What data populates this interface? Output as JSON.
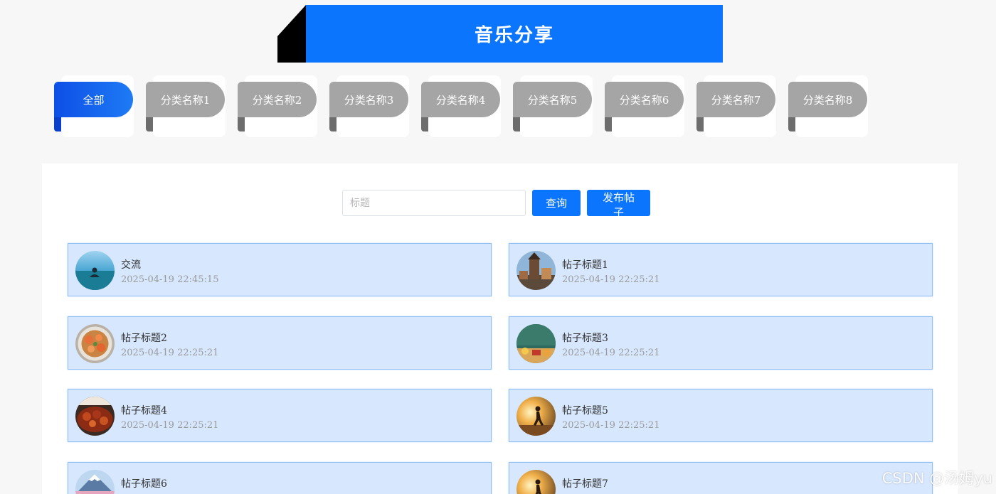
{
  "header": {
    "title": "音乐分享"
  },
  "tabs": [
    {
      "label": "全部",
      "active": true
    },
    {
      "label": "分类名称1",
      "active": false
    },
    {
      "label": "分类名称2",
      "active": false
    },
    {
      "label": "分类名称3",
      "active": false
    },
    {
      "label": "分类名称4",
      "active": false
    },
    {
      "label": "分类名称5",
      "active": false
    },
    {
      "label": "分类名称6",
      "active": false
    },
    {
      "label": "分类名称7",
      "active": false
    },
    {
      "label": "分类名称8",
      "active": false
    }
  ],
  "search": {
    "placeholder": "标题",
    "value": "",
    "query_label": "查询",
    "post_label": "发布帖子"
  },
  "posts": [
    {
      "title": "交流",
      "time": "2025-04-19 22:45:15",
      "thumb": "meditation-sea-thumbnail"
    },
    {
      "title": "帖子标题1",
      "time": "2025-04-19 22:25:21",
      "thumb": "prague-tower-thumbnail"
    },
    {
      "title": "帖子标题2",
      "time": "2025-04-19 22:25:21",
      "thumb": "shrimp-dish-thumbnail"
    },
    {
      "title": "帖子标题3",
      "time": "2025-04-19 22:25:21",
      "thumb": "classroom-thumbnail"
    },
    {
      "title": "帖子标题4",
      "time": "2025-04-19 22:25:21",
      "thumb": "food-plate-thumbnail"
    },
    {
      "title": "帖子标题5",
      "time": "2025-04-19 22:25:21",
      "thumb": "runner-sunset-thumbnail"
    },
    {
      "title": "帖子标题6",
      "time": "",
      "thumb": "mountain-fuji-thumbnail"
    },
    {
      "title": "帖子标题7",
      "time": "",
      "thumb": "runner-sunset-thumbnail"
    }
  ],
  "watermark": "CSDN @汤姆yu",
  "colors": {
    "primary": "#0b75fe",
    "post_bg": "#d7e7fd",
    "post_border": "#8fbdf6",
    "tab_inactive": "#a5a5a5"
  }
}
